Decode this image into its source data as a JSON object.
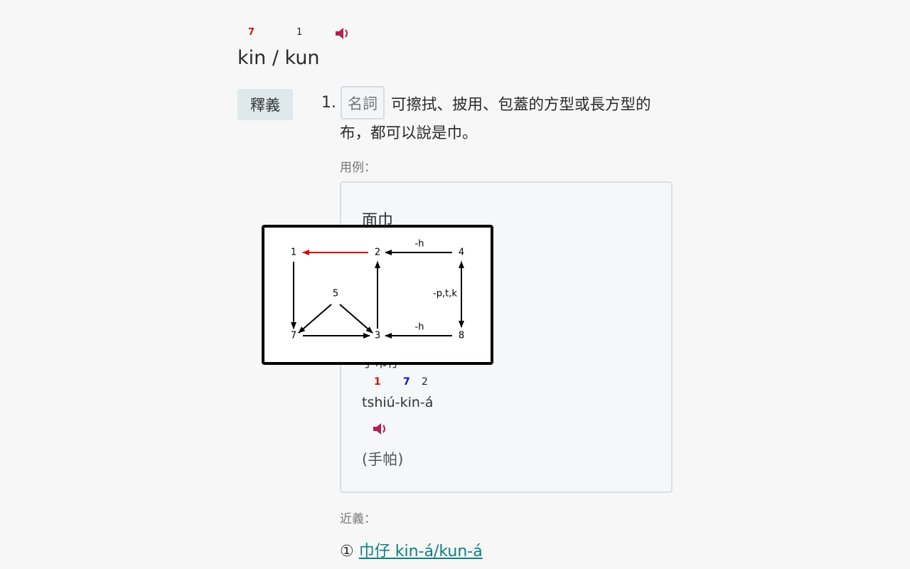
{
  "entry": {
    "tone_marks": [
      "7",
      "1"
    ],
    "headword": "kin / kun",
    "speaker_icon": "speaker-icon"
  },
  "definition": {
    "label": "釋義",
    "number": "1.",
    "pos": "名詞",
    "text": "可擦拭、披用、包蓋的方型或長方型的布，都可以說是巾。"
  },
  "examples": {
    "label": "用例：",
    "items": [
      {
        "hanji": "面巾"
      },
      {
        "hanji_visible_tail": "手巾仔",
        "tone_marks": [
          "1",
          "7",
          "2"
        ],
        "romanization": "tshiú-kin-á",
        "gloss": "(手帕)"
      }
    ]
  },
  "synonyms": {
    "label": "近義：",
    "items": [
      {
        "marker": "①",
        "text": "巾仔 kin-á/kun-á"
      }
    ]
  },
  "tone_diagram": {
    "nodes": [
      "1",
      "2",
      "4",
      "5",
      "7",
      "3",
      "8"
    ],
    "edge_labels": [
      "-h",
      "-p,t,k",
      "-h"
    ],
    "colors": {
      "highlight_edge": "#e00000",
      "edge": "#000000"
    }
  },
  "colors": {
    "tone_red": "#e01010",
    "tone_blue": "#1010d0",
    "speaker": "#b5204f",
    "link": "#0f7f7f",
    "label_bg": "#dfe9eb"
  }
}
